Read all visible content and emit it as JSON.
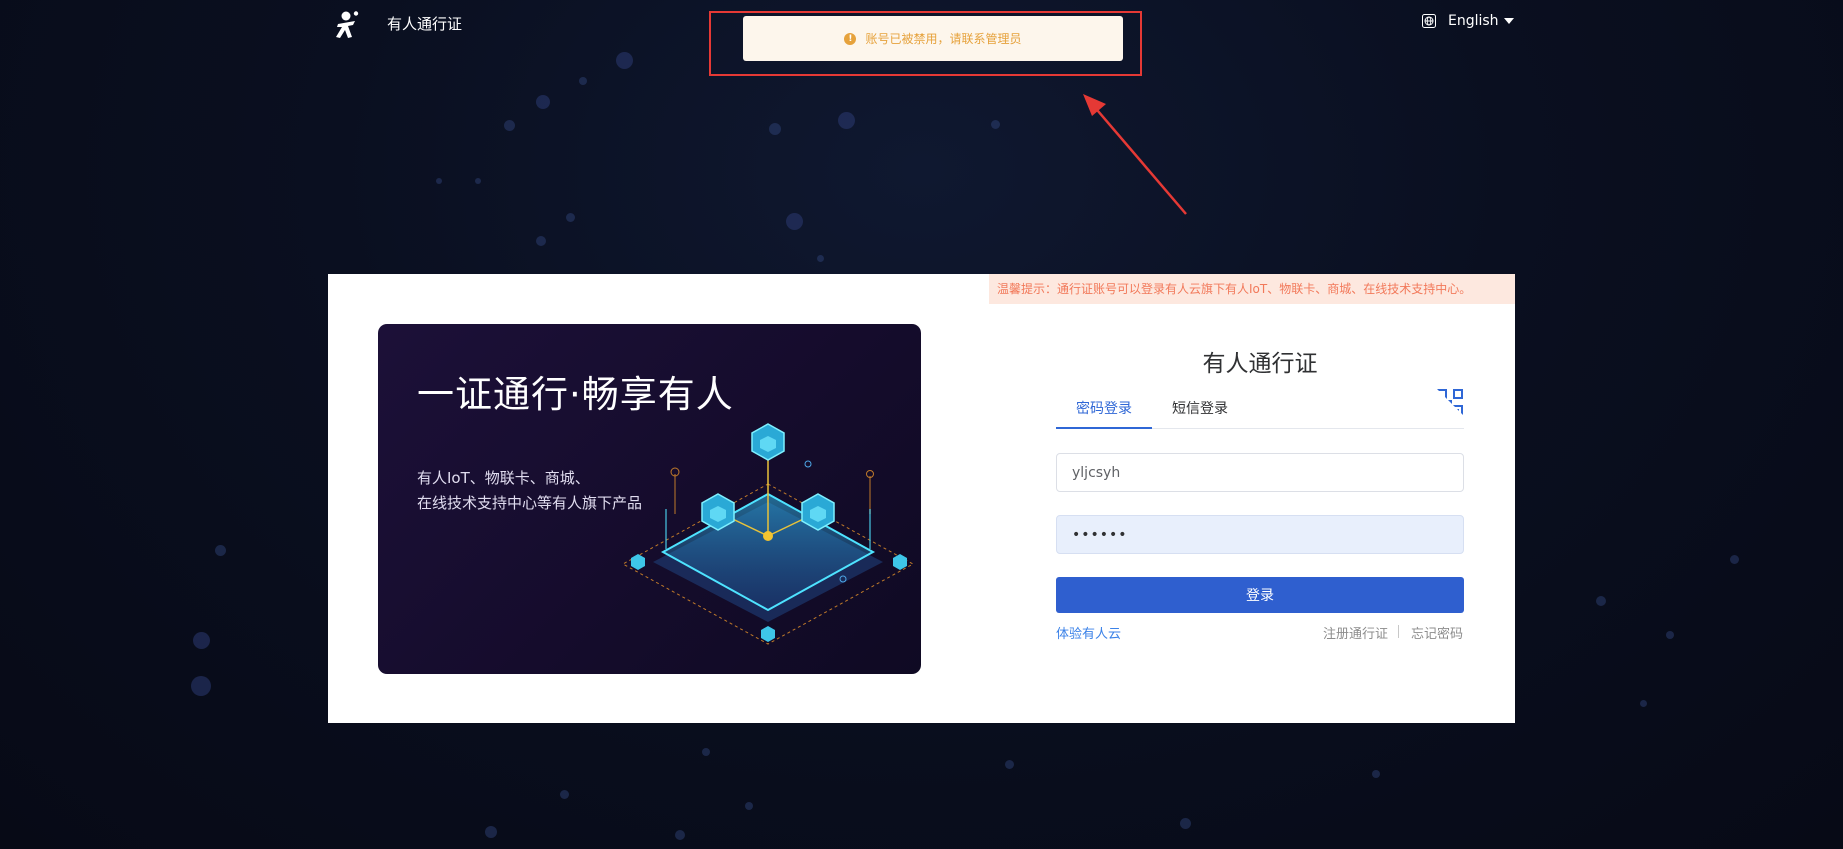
{
  "header": {
    "brand": "有人通行证",
    "language": "English"
  },
  "toast": {
    "message": "账号已被禁用，请联系管理员",
    "icon": "warning-icon",
    "color": "#e6a23c"
  },
  "notice": {
    "text": "温馨提示：通行证账号可以登录有人云旗下有人IoT、物联卡、商城、在线技术支持中心。"
  },
  "banner": {
    "title": "一证通行·畅享有人",
    "line1": "有人IoT、物联卡、商城、",
    "line2": "在线技术支持中心等有人旗下产品"
  },
  "login": {
    "title": "有人通行证",
    "tabs": [
      {
        "label": "密码登录",
        "active": true
      },
      {
        "label": "短信登录",
        "active": false
      }
    ],
    "username": "yljcsyh",
    "password": "••••••",
    "submit_label": "登录",
    "trial_link": "体验有人云",
    "register_link": "注册通行证",
    "forgot_link": "忘记密码"
  },
  "colors": {
    "primary": "#2f5fcf",
    "link": "#3b82e8",
    "warning": "#e6a23c",
    "highlight": "#e53935"
  }
}
